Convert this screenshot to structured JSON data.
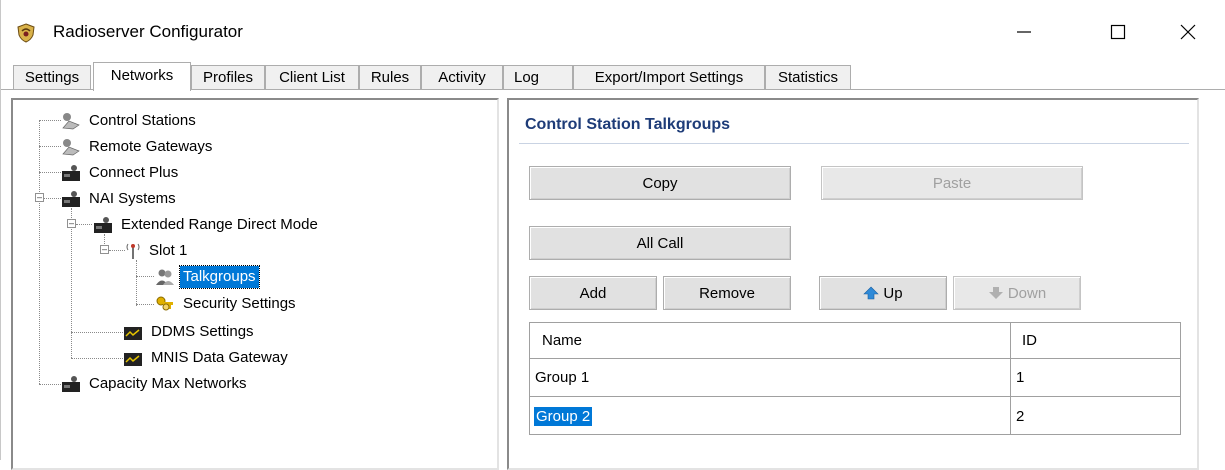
{
  "window": {
    "title": "Radioserver Configurator",
    "icon": "radioserver-app-icon",
    "controls": {
      "minimize": "minimize-icon",
      "maximize": "maximize-icon",
      "close": "close-icon"
    }
  },
  "tabs": [
    {
      "label": "Settings",
      "active": false
    },
    {
      "label": "Networks",
      "active": true
    },
    {
      "label": "Profiles",
      "active": false
    },
    {
      "label": "Client List",
      "active": false
    },
    {
      "label": "Rules",
      "active": false
    },
    {
      "label": "Activity",
      "active": false
    },
    {
      "label": "Log",
      "active": false
    },
    {
      "label": "Export/Import Settings",
      "active": false
    },
    {
      "label": "Statistics",
      "active": false
    }
  ],
  "tree": {
    "items": [
      {
        "label": "Control Stations",
        "icon": "control-station-icon"
      },
      {
        "label": "Remote Gateways",
        "icon": "remote-gateway-icon"
      },
      {
        "label": "Connect Plus",
        "icon": "radio-system-icon"
      },
      {
        "label": "NAI Systems",
        "icon": "radio-system-icon",
        "expanded": true
      },
      {
        "label": "Extended Range Direct Mode",
        "icon": "radio-system-icon",
        "expanded": true
      },
      {
        "label": "Slot 1",
        "icon": "antenna-icon",
        "expanded": true
      },
      {
        "label": "Talkgroups",
        "icon": "talkgroups-icon",
        "selected": true
      },
      {
        "label": "Security Settings",
        "icon": "security-keys-icon"
      },
      {
        "label": "DDMS Settings",
        "icon": "ddms-icon"
      },
      {
        "label": "MNIS Data Gateway",
        "icon": "mnis-icon"
      },
      {
        "label": "Capacity Max Networks",
        "icon": "radio-system-icon"
      }
    ]
  },
  "panel": {
    "title": "Control Station Talkgroups",
    "buttons": {
      "copy": "Copy",
      "paste": "Paste",
      "all_call": "All Call",
      "add": "Add",
      "remove": "Remove",
      "up": "Up",
      "down": "Down"
    },
    "table": {
      "columns": [
        "Name",
        "ID"
      ],
      "rows": [
        {
          "name": "Group 1",
          "id": "1"
        },
        {
          "name": "Group 2",
          "id": "2",
          "selected": true
        }
      ]
    }
  },
  "colors": {
    "selection": "#0078d7",
    "section_title": "#1e3c78",
    "up_arrow": "#2e8ad8"
  }
}
